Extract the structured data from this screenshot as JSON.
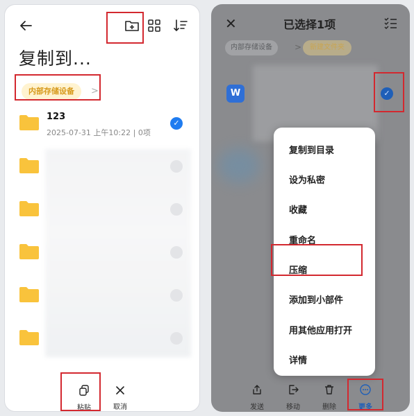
{
  "left": {
    "title": "复制到...",
    "breadcrumb": "内部存储设备",
    "breadcrumb_arrow": ">",
    "folders": [
      {
        "name": "123",
        "meta": "2025-07-31 上午10:22 | 0项",
        "checked": true
      },
      {
        "name": "",
        "meta": "",
        "checked": false
      },
      {
        "name": "",
        "meta": "",
        "checked": false
      },
      {
        "name": "",
        "meta": "",
        "checked": false
      },
      {
        "name": "",
        "meta": "",
        "checked": false
      },
      {
        "name": "",
        "meta": "",
        "checked": false
      }
    ],
    "actions": {
      "paste": "粘贴",
      "cancel": "取消"
    }
  },
  "right": {
    "title": "已选择1项",
    "breadcrumb_1": "内部存储设备",
    "breadcrumb_arrow": ">",
    "breadcrumb_2": "新建文件夹",
    "file_icon_letter": "W",
    "menu": [
      "复制到目录",
      "设为私密",
      "收藏",
      "重命名",
      "压缩",
      "添加到小部件",
      "用其他应用打开",
      "详情"
    ],
    "bottom": {
      "send": "发送",
      "move": "移动",
      "delete": "删除",
      "more": "更多"
    }
  },
  "colors": {
    "accent": "#1f7cf0",
    "folder": "#f9c33c",
    "annotation": "#d3282f",
    "chip_bg": "#fff3d0",
    "chip_text": "#d79a1c"
  }
}
